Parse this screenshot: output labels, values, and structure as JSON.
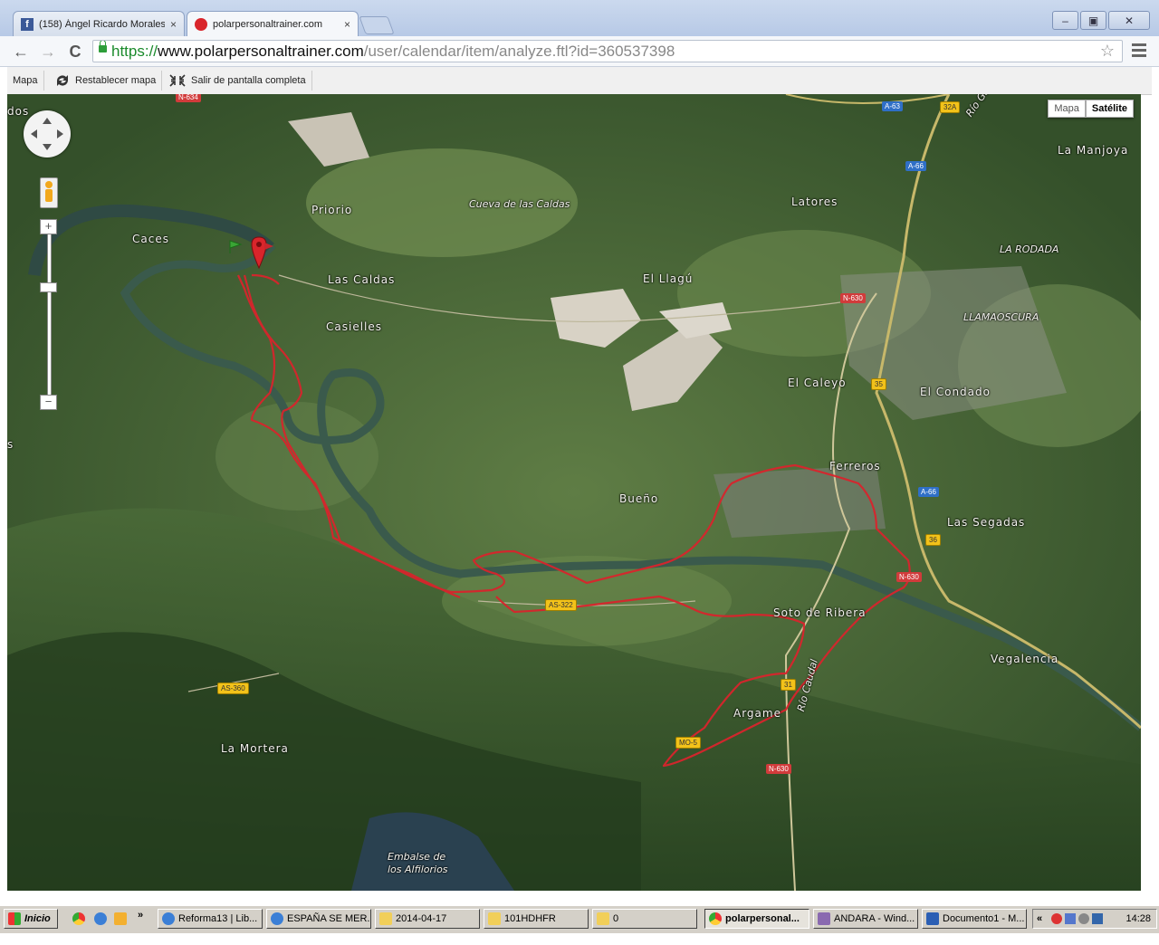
{
  "browser": {
    "tabs": [
      {
        "label": "(158) Ángel Ricardo Morales",
        "close": "×",
        "favicon": "facebook-icon"
      },
      {
        "label": "polarpersonaltrainer.com",
        "close": "×",
        "favicon": "polar-icon"
      }
    ],
    "window_buttons": {
      "minimize": "–",
      "maximize": "▣",
      "close": "✕"
    },
    "nav": {
      "back": "←",
      "forward": "→",
      "reload": "C"
    },
    "url": {
      "scheme": "https://",
      "host": "www.polarpersonaltrainer.com",
      "path": "/user/calendar/item/analyze.ftl?id=360537398"
    },
    "bookmark_star": "☆"
  },
  "appbar": {
    "mapa": "Mapa",
    "reset": "Restablecer mapa",
    "exit_fullscreen": "Salir de pantalla completa"
  },
  "map": {
    "type_buttons": {
      "map": "Mapa",
      "satellite": "Satélite",
      "selected": "Satélite"
    },
    "zoom": {
      "plus": "+",
      "minus": "−"
    },
    "labels": {
      "dos": "dos",
      "caces": "Caces",
      "priorio": "Priorio",
      "cueva": "Cueva de las Caldas",
      "latores": "Latores",
      "la_manjoya": "La Manjoya",
      "la_rodada": "LA RODADA",
      "las_caldas": "Las Caldas",
      "casielles": "Casielles",
      "el_llagu": "El Llagú",
      "llamaoscura": "LLAMAOSCURA",
      "el_caleyo": "El Caleyo",
      "el_condado": "El Condado",
      "ferreros": "Ferreros",
      "bueno": "Bueño",
      "las_segadas": "Las Segadas",
      "soto_de_ribera": "Soto de Ribera",
      "vegalencia": "Vegalencia",
      "argame": "Argame",
      "rio_caudal": "Río Caudal",
      "la_mortera": "La Mortera",
      "embalse": "Embalse de",
      "embalse2": "los Alfilorios",
      "rio_gafo": "Río Gafo",
      "s_left": "s"
    },
    "road_signs": {
      "n634": "N-634",
      "a63": "A-63",
      "s32a": "32A",
      "a66_top": "A-66",
      "n630_top": "N-630",
      "s35": "35",
      "a66_mid": "A-66",
      "s36": "36",
      "n630_mid": "N-630",
      "as322": "AS-322",
      "as360": "AS-360",
      "mo5": "MO-5",
      "n630_bot": "N-630",
      "s31": "31"
    }
  },
  "taskbar": {
    "start": "Inicio",
    "quicklaunch_more": "»",
    "items": [
      {
        "label": "Reforma13 | Lib...",
        "icon": "ie-icon"
      },
      {
        "label": "ESPAÑA SE MER...",
        "icon": "ie-icon"
      },
      {
        "label": "2014-04-17",
        "icon": "folder-icon"
      },
      {
        "label": "101HDHFR",
        "icon": "folder-icon"
      },
      {
        "label": "0",
        "icon": "folder-icon"
      },
      {
        "label": "polarpersonal...",
        "icon": "chrome-icon"
      },
      {
        "label": "ANDARA - Wind...",
        "icon": "app-icon"
      },
      {
        "label": "Documento1 - M...",
        "icon": "word-icon"
      }
    ],
    "tray_more": "«",
    "clock": "14:28"
  }
}
